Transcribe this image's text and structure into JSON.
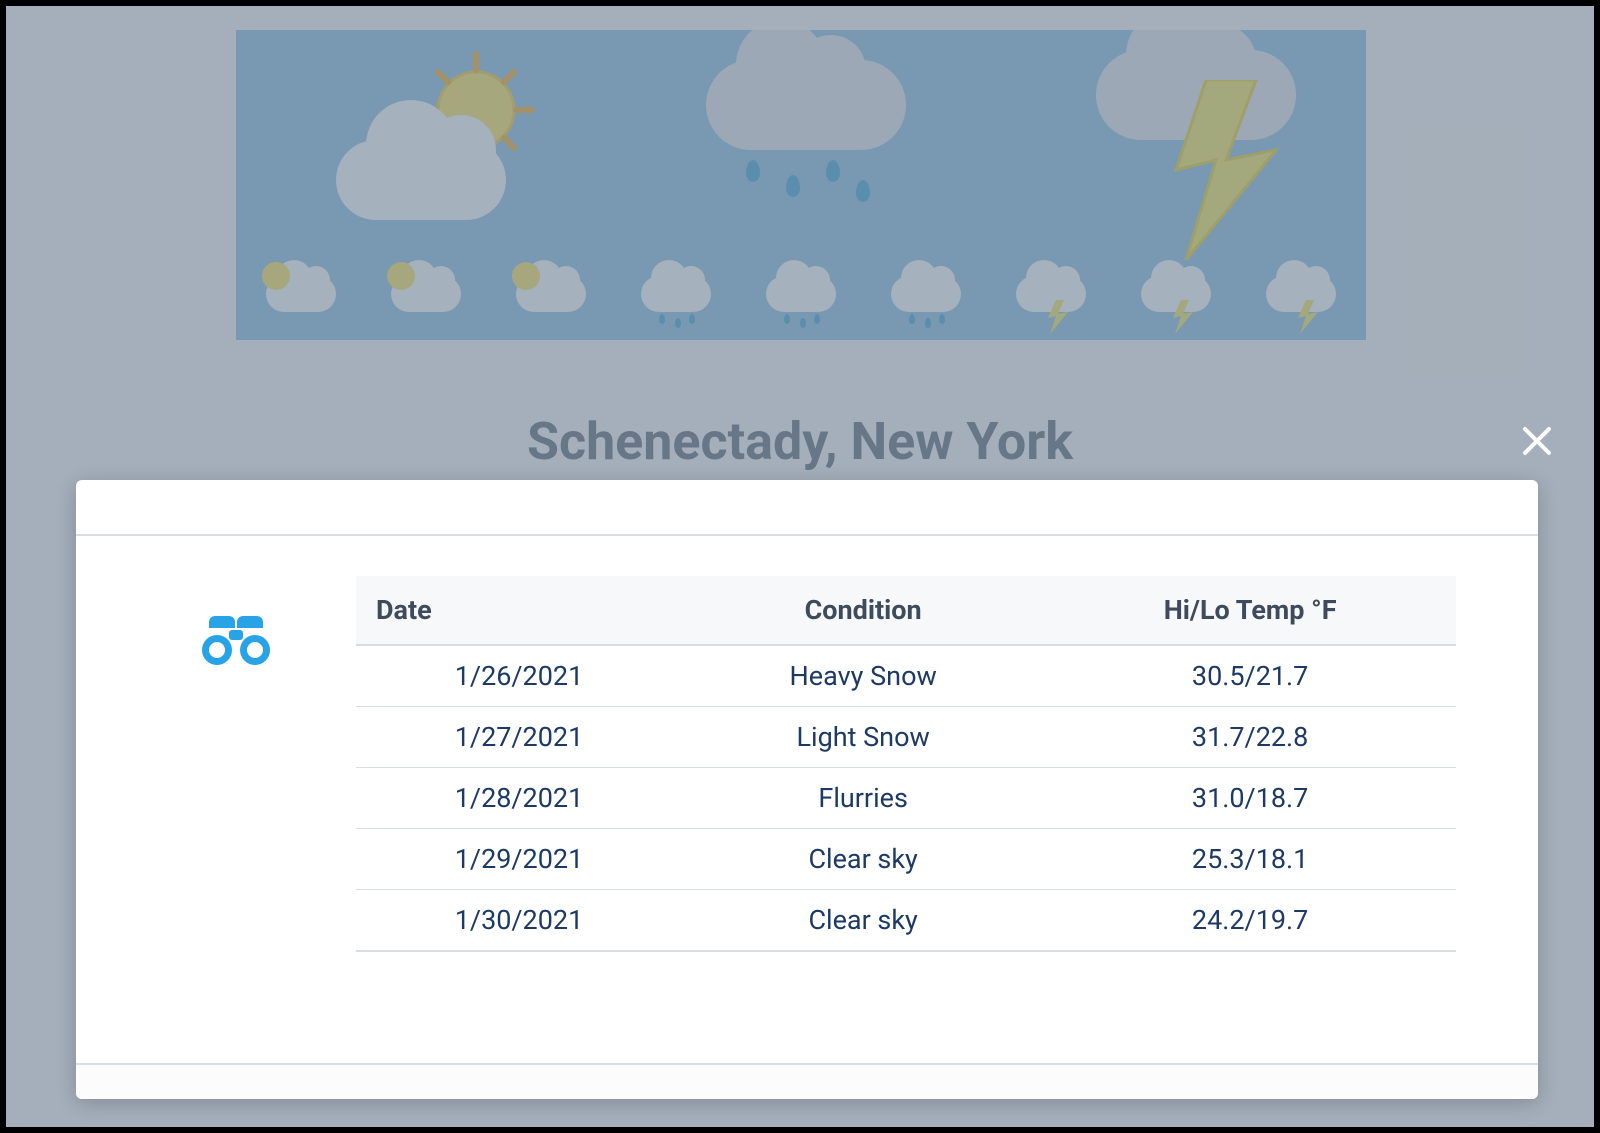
{
  "page": {
    "location_title": "Schenectady, New York"
  },
  "modal": {
    "icon": "binoculars-icon",
    "close_label": "Close"
  },
  "forecast_table": {
    "headers": {
      "date": "Date",
      "condition": "Condition",
      "temp": "Hi/Lo Temp °F"
    },
    "rows": [
      {
        "date": "1/26/2021",
        "condition": "Heavy Snow",
        "temp": "30.5/21.7"
      },
      {
        "date": "1/27/2021",
        "condition": "Light Snow",
        "temp": "31.7/22.8"
      },
      {
        "date": "1/28/2021",
        "condition": "Flurries",
        "temp": "31.0/18.7"
      },
      {
        "date": "1/29/2021",
        "condition": "Clear sky",
        "temp": "25.3/18.1"
      },
      {
        "date": "1/30/2021",
        "condition": "Clear sky",
        "temp": "24.2/19.7"
      }
    ]
  },
  "colors": {
    "accent_icon": "#29a3e8",
    "table_text": "#1d3a66"
  }
}
